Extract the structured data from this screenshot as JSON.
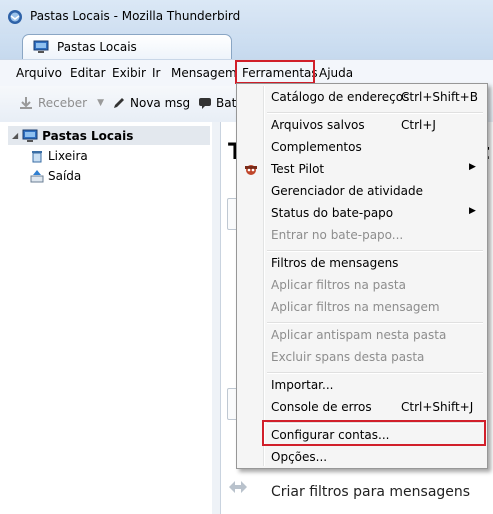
{
  "window": {
    "title": "Pastas Locais - Mozilla Thunderbird"
  },
  "tab": {
    "label": "Pastas Locais"
  },
  "menubar": {
    "items": [
      {
        "label": "Arquivo"
      },
      {
        "label": "Editar"
      },
      {
        "label": "Exibir"
      },
      {
        "label": "Ir"
      },
      {
        "label": "Mensagem"
      },
      {
        "label": "Ferramentas"
      },
      {
        "label": "Ajuda"
      }
    ]
  },
  "toolbar": {
    "receive_label": "Receber",
    "new_msg_label": "Nova msg",
    "chat_label": "Bate"
  },
  "folders": [
    {
      "label": "Pastas Locais"
    },
    {
      "label": "Lixeira"
    },
    {
      "label": "Saída"
    }
  ],
  "content": {
    "heading_left": "T",
    "heading_right": "t",
    "create_filters": "Criar filtros para mensagens"
  },
  "tools_menu": {
    "items": [
      {
        "label": "Catálogo de endereços",
        "shortcut": "Ctrl+Shift+B"
      },
      {
        "label": "Arquivos salvos",
        "shortcut": "Ctrl+J"
      },
      {
        "label": "Complementos"
      },
      {
        "label": "Test Pilot"
      },
      {
        "label": "Gerenciador de atividade"
      },
      {
        "label": "Status do bate-papo"
      },
      {
        "label": "Entrar no bate-papo..."
      },
      {
        "label": "Filtros de mensagens"
      },
      {
        "label": "Aplicar filtros na pasta"
      },
      {
        "label": "Aplicar filtros na mensagem"
      },
      {
        "label": "Aplicar antispam nesta pasta"
      },
      {
        "label": "Excluir spans desta pasta"
      },
      {
        "label": "Importar..."
      },
      {
        "label": "Console de erros",
        "shortcut": "Ctrl+Shift+J"
      },
      {
        "label": "Configurar contas..."
      },
      {
        "label": "Opções..."
      }
    ]
  },
  "colors": {
    "highlight": "#d11f2a",
    "accent": "#1c5cae"
  }
}
